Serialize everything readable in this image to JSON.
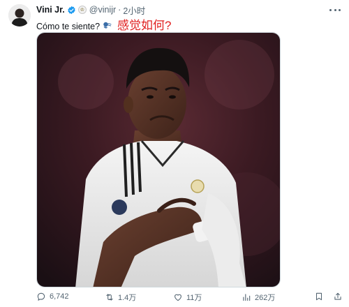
{
  "author": {
    "name": "Vini Jr.",
    "handle": "@vinijr",
    "separator": "·",
    "time": "2小时"
  },
  "tweet": {
    "text_es": "Cómo te siente?",
    "text_zh": "感觉如何?"
  },
  "actions": {
    "reply_count": "6,742",
    "retweet_count": "1.4万",
    "like_count": "11万",
    "view_count": "262万"
  },
  "icons": [
    "avatar",
    "verified-icon",
    "club-badge-icon",
    "more-icon",
    "speech-icon",
    "reply-icon",
    "retweet-icon",
    "like-icon",
    "views-icon",
    "bookmark-icon",
    "share-icon"
  ],
  "colors": {
    "text": "#0f1419",
    "secondary": "#536471",
    "verified": "#1d9bf0",
    "highlight_red": "#e02020"
  }
}
